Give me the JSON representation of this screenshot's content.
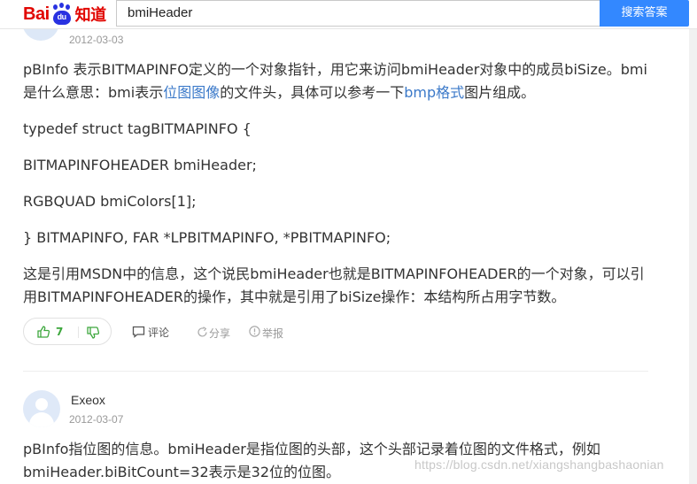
{
  "header": {
    "logo_text_left": "Bai",
    "logo_paw_text": "du",
    "logo_text_right": "知道",
    "search_value": "bmiHeader",
    "search_button": "搜索答案"
  },
  "answer1": {
    "date": "2012-03-03",
    "p1_a": "pBInfo 表示BITMAPINFO定义的一个对象指针，用它来访问bmiHeader对象中的成员biSize。bmi是什么意思：bmi表示",
    "p1_link1": "位图图像",
    "p1_b": "的文件头，具体可以参考一下",
    "p1_link2": "bmp格式",
    "p1_c": "图片组成。",
    "code1": "typedef struct tagBITMAPINFO {",
    "code2": "BITMAPINFOHEADER bmiHeader;",
    "code3": "RGBQUAD bmiColors[1];",
    "code4": "} BITMAPINFO, FAR *LPBITMAPINFO, *PBITMAPINFO;",
    "p2": "这是引用MSDN中的信息，这个说民bmiHeader也就是BITMAPINFOHEADER的一个对象，可以引用BITMAPINFOHEADER的操作，其中就是引用了biSize操作：本结构所占用字节数。",
    "actions": {
      "like_count": "7",
      "comment": "评论",
      "share": "分享",
      "report": "举报"
    }
  },
  "answer2": {
    "username": "Exeox",
    "date": "2012-03-07",
    "text": "pBInfo指位图的信息。bmiHeader是指位图的头部，这个头部记录着位图的文件格式，例如bmiHeader.biBitCount=32表示是32位的位图。"
  },
  "watermark": "https://blog.csdn.net/xiangshangbashaonian",
  "colors": {
    "brand_red": "#e10601",
    "brand_blue": "#2932e1",
    "button_blue": "#3388ff",
    "link_blue": "#3b79c9",
    "like_green": "#3da73d"
  }
}
